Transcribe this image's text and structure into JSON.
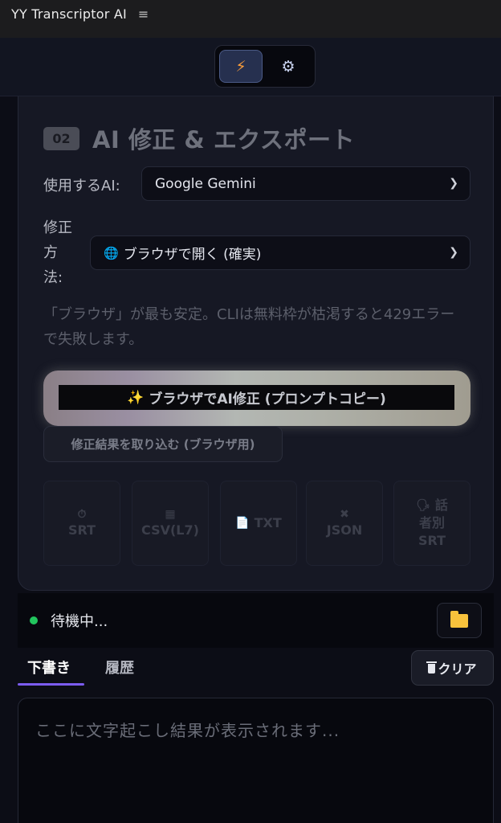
{
  "window": {
    "title": "YY Transcriptor AI",
    "menu_icon": "≡"
  },
  "nav": {
    "toggle_active_icon": "⚡",
    "toggle_inactive_icon": "⚙"
  },
  "section": {
    "number": "02",
    "title": "AI 修正 & エクスポート",
    "ai_label": "使用するAI:",
    "ai_selected": "Google Gemini",
    "method_label_lines": [
      "修正",
      "方",
      "法:"
    ],
    "method_icon": "🌐",
    "method_selected": "ブラウザで開く (確実)",
    "hint": "「ブラウザ」が最も安定。CLIは無料枠が枯渇すると429エラーで失敗します。",
    "primary_button_icon": "✨",
    "primary_button": "ブラウザでAI修正 (プロンプトコピー)",
    "import_button": "修正結果を取り込む (ブラウザ用)",
    "exports": [
      {
        "icon": "⏱",
        "label": "SRT"
      },
      {
        "icon": "▦",
        "label": "CSV(L7)"
      },
      {
        "icon": "📄",
        "label": "TXT"
      },
      {
        "icon": "✖",
        "label": "JSON"
      },
      {
        "icon": "🗣",
        "label_lines": [
          "話",
          "者別",
          "SRT"
        ]
      }
    ]
  },
  "status": {
    "text": "待機中...",
    "color": "#22c55e"
  },
  "tabs": {
    "draft": "下書き",
    "history": "履歴"
  },
  "clear_button": "クリア",
  "output": {
    "placeholder": "ここに文字起こし結果が表示されます..."
  },
  "colors": {
    "accent": "#7c5cf0",
    "folder": "#f8c23c",
    "bolt": "#ff9f3a"
  }
}
